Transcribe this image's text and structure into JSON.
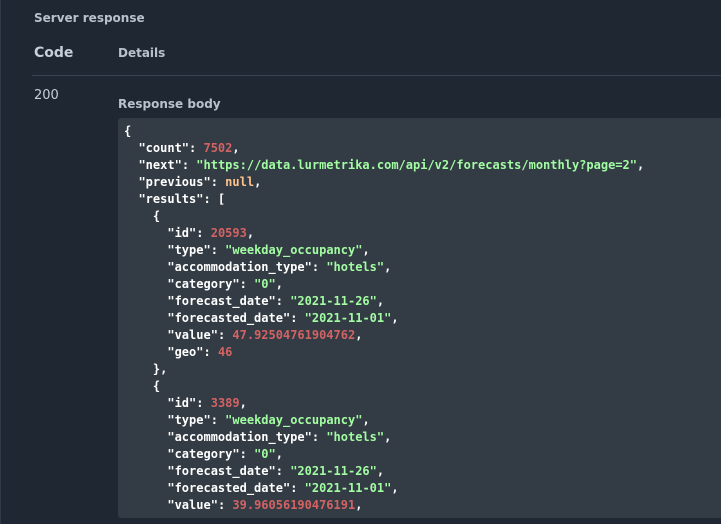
{
  "panel": {
    "title": "Server response",
    "columns": {
      "code": "Code",
      "details": "Details"
    },
    "response": {
      "status_code": "200",
      "body_label": "Response body",
      "body_lines": [
        [
          {
            "t": "p",
            "v": "{"
          }
        ],
        [
          {
            "t": "p",
            "v": "  "
          },
          {
            "t": "k",
            "v": "\"count\""
          },
          {
            "t": "p",
            "v": ": "
          },
          {
            "t": "n",
            "v": "7502"
          },
          {
            "t": "p",
            "v": ","
          }
        ],
        [
          {
            "t": "p",
            "v": "  "
          },
          {
            "t": "k",
            "v": "\"next\""
          },
          {
            "t": "p",
            "v": ": "
          },
          {
            "t": "s",
            "v": "\"https://data.lurmetrika.com/api/v2/forecasts/monthly?page=2\""
          },
          {
            "t": "p",
            "v": ","
          }
        ],
        [
          {
            "t": "p",
            "v": "  "
          },
          {
            "t": "k",
            "v": "\"previous\""
          },
          {
            "t": "p",
            "v": ": "
          },
          {
            "t": "l",
            "v": "null"
          },
          {
            "t": "p",
            "v": ","
          }
        ],
        [
          {
            "t": "p",
            "v": "  "
          },
          {
            "t": "k",
            "v": "\"results\""
          },
          {
            "t": "p",
            "v": ": ["
          }
        ],
        [
          {
            "t": "p",
            "v": "    {"
          }
        ],
        [
          {
            "t": "p",
            "v": "      "
          },
          {
            "t": "k",
            "v": "\"id\""
          },
          {
            "t": "p",
            "v": ": "
          },
          {
            "t": "n",
            "v": "20593"
          },
          {
            "t": "p",
            "v": ","
          }
        ],
        [
          {
            "t": "p",
            "v": "      "
          },
          {
            "t": "k",
            "v": "\"type\""
          },
          {
            "t": "p",
            "v": ": "
          },
          {
            "t": "s",
            "v": "\"weekday_occupancy\""
          },
          {
            "t": "p",
            "v": ","
          }
        ],
        [
          {
            "t": "p",
            "v": "      "
          },
          {
            "t": "k",
            "v": "\"accommodation_type\""
          },
          {
            "t": "p",
            "v": ": "
          },
          {
            "t": "s",
            "v": "\"hotels\""
          },
          {
            "t": "p",
            "v": ","
          }
        ],
        [
          {
            "t": "p",
            "v": "      "
          },
          {
            "t": "k",
            "v": "\"category\""
          },
          {
            "t": "p",
            "v": ": "
          },
          {
            "t": "s",
            "v": "\"0\""
          },
          {
            "t": "p",
            "v": ","
          }
        ],
        [
          {
            "t": "p",
            "v": "      "
          },
          {
            "t": "k",
            "v": "\"forecast_date\""
          },
          {
            "t": "p",
            "v": ": "
          },
          {
            "t": "s",
            "v": "\"2021-11-26\""
          },
          {
            "t": "p",
            "v": ","
          }
        ],
        [
          {
            "t": "p",
            "v": "      "
          },
          {
            "t": "k",
            "v": "\"forecasted_date\""
          },
          {
            "t": "p",
            "v": ": "
          },
          {
            "t": "s",
            "v": "\"2021-11-01\""
          },
          {
            "t": "p",
            "v": ","
          }
        ],
        [
          {
            "t": "p",
            "v": "      "
          },
          {
            "t": "k",
            "v": "\"value\""
          },
          {
            "t": "p",
            "v": ": "
          },
          {
            "t": "n",
            "v": "47.92504761904762"
          },
          {
            "t": "p",
            "v": ","
          }
        ],
        [
          {
            "t": "p",
            "v": "      "
          },
          {
            "t": "k",
            "v": "\"geo\""
          },
          {
            "t": "p",
            "v": ": "
          },
          {
            "t": "n",
            "v": "46"
          }
        ],
        [
          {
            "t": "p",
            "v": "    },"
          }
        ],
        [
          {
            "t": "p",
            "v": "    {"
          }
        ],
        [
          {
            "t": "p",
            "v": "      "
          },
          {
            "t": "k",
            "v": "\"id\""
          },
          {
            "t": "p",
            "v": ": "
          },
          {
            "t": "n",
            "v": "3389"
          },
          {
            "t": "p",
            "v": ","
          }
        ],
        [
          {
            "t": "p",
            "v": "      "
          },
          {
            "t": "k",
            "v": "\"type\""
          },
          {
            "t": "p",
            "v": ": "
          },
          {
            "t": "s",
            "v": "\"weekday_occupancy\""
          },
          {
            "t": "p",
            "v": ","
          }
        ],
        [
          {
            "t": "p",
            "v": "      "
          },
          {
            "t": "k",
            "v": "\"accommodation_type\""
          },
          {
            "t": "p",
            "v": ": "
          },
          {
            "t": "s",
            "v": "\"hotels\""
          },
          {
            "t": "p",
            "v": ","
          }
        ],
        [
          {
            "t": "p",
            "v": "      "
          },
          {
            "t": "k",
            "v": "\"category\""
          },
          {
            "t": "p",
            "v": ": "
          },
          {
            "t": "s",
            "v": "\"0\""
          },
          {
            "t": "p",
            "v": ","
          }
        ],
        [
          {
            "t": "p",
            "v": "      "
          },
          {
            "t": "k",
            "v": "\"forecast_date\""
          },
          {
            "t": "p",
            "v": ": "
          },
          {
            "t": "s",
            "v": "\"2021-11-26\""
          },
          {
            "t": "p",
            "v": ","
          }
        ],
        [
          {
            "t": "p",
            "v": "      "
          },
          {
            "t": "k",
            "v": "\"forecasted_date\""
          },
          {
            "t": "p",
            "v": ": "
          },
          {
            "t": "s",
            "v": "\"2021-11-01\""
          },
          {
            "t": "p",
            "v": ","
          }
        ],
        [
          {
            "t": "p",
            "v": "      "
          },
          {
            "t": "k",
            "v": "\"value\""
          },
          {
            "t": "p",
            "v": ": "
          },
          {
            "t": "n",
            "v": "39.96056190476191"
          },
          {
            "t": "p",
            "v": ","
          }
        ]
      ]
    }
  },
  "colors": {
    "background": "#1e2732",
    "code_background": "#333b44",
    "json_key": "#ffffff",
    "json_string": "#a2fca2",
    "json_number": "#d36363",
    "json_literal": "#fcc28c"
  }
}
